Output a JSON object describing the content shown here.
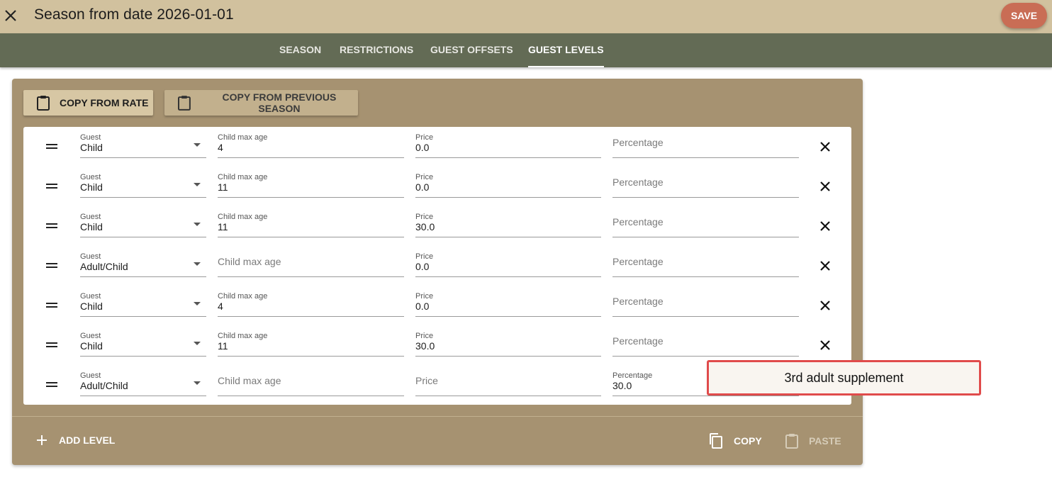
{
  "header": {
    "title": "Season from date 2026-01-01",
    "save_label": "SAVE",
    "close_icon": "close-icon"
  },
  "tabs": [
    {
      "label": "SEASON",
      "active": false
    },
    {
      "label": "RESTRICTIONS",
      "active": false
    },
    {
      "label": "GUEST OFFSETS",
      "active": false
    },
    {
      "label": "GUEST LEVELS",
      "active": true
    }
  ],
  "toolbar": {
    "copy_from_rate": "COPY FROM RATE",
    "copy_from_previous_season": "COPY FROM PREVIOUS SEASON"
  },
  "field_labels": {
    "guest": "Guest",
    "child_max_age": "Child max age",
    "price": "Price",
    "percentage": "Percentage"
  },
  "levels": [
    {
      "guest": "Child",
      "child_max_age": "4",
      "price": "0.0",
      "percentage": ""
    },
    {
      "guest": "Child",
      "child_max_age": "11",
      "price": "0.0",
      "percentage": ""
    },
    {
      "guest": "Child",
      "child_max_age": "11",
      "price": "30.0",
      "percentage": ""
    },
    {
      "guest": "Adult/Child",
      "child_max_age": "",
      "price": "0.0",
      "percentage": ""
    },
    {
      "guest": "Child",
      "child_max_age": "4",
      "price": "0.0",
      "percentage": ""
    },
    {
      "guest": "Child",
      "child_max_age": "11",
      "price": "30.0",
      "percentage": ""
    },
    {
      "guest": "Adult/Child",
      "child_max_age": "",
      "price": "",
      "percentage": "30.0"
    }
  ],
  "footer": {
    "add_level": "ADD LEVEL",
    "copy": "COPY",
    "paste": "PASTE"
  },
  "tooltip": {
    "text": "3rd adult supplement"
  },
  "colors": {
    "header_bg": "#d1c19e",
    "tabbar_bg": "#636b55",
    "card_bg": "#a69271",
    "save_bg": "#c96d55",
    "tooltip_border": "#e04b4b"
  }
}
